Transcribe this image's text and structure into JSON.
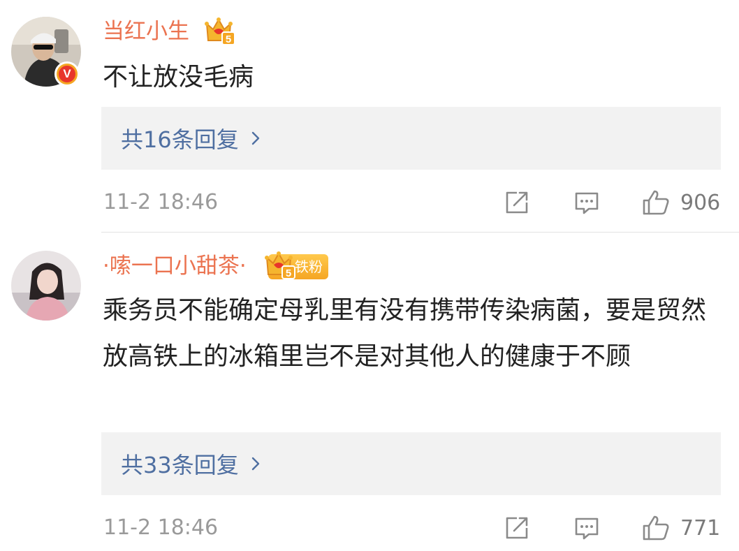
{
  "comments": [
    {
      "username": "当红小生",
      "verified": true,
      "member_level": "5",
      "badge_label": "",
      "text": "不让放没毛病",
      "replies_label": "共16条回复",
      "timestamp": "11-2 18:46",
      "like_count": "906"
    },
    {
      "username": "·嗦一口小甜茶·",
      "verified": false,
      "member_level": "5",
      "badge_label": "铁粉",
      "text": "乘务员不能确定母乳里有没有携带传染病菌，要是贸然放高铁上的冰箱里岂不是对其他人的健康于不顾",
      "replies_label": "共33条回复",
      "timestamp": "11-2 18:46",
      "like_count": "771"
    }
  ],
  "icons": {
    "repost": "share-edit-icon",
    "comment": "comment-icon",
    "like": "thumbs-up-icon",
    "replies_arrow": "chevron-right-icon",
    "verified": "verified-v-icon",
    "member": "crown-member-icon"
  },
  "colors": {
    "username": "#eb7350",
    "replies_link": "#4f6fa1",
    "reply_box_bg": "#f2f2f2",
    "meta_text": "#9a9a9a",
    "verified_badge": "#f5a623",
    "fan_badge": "#f5a623"
  }
}
